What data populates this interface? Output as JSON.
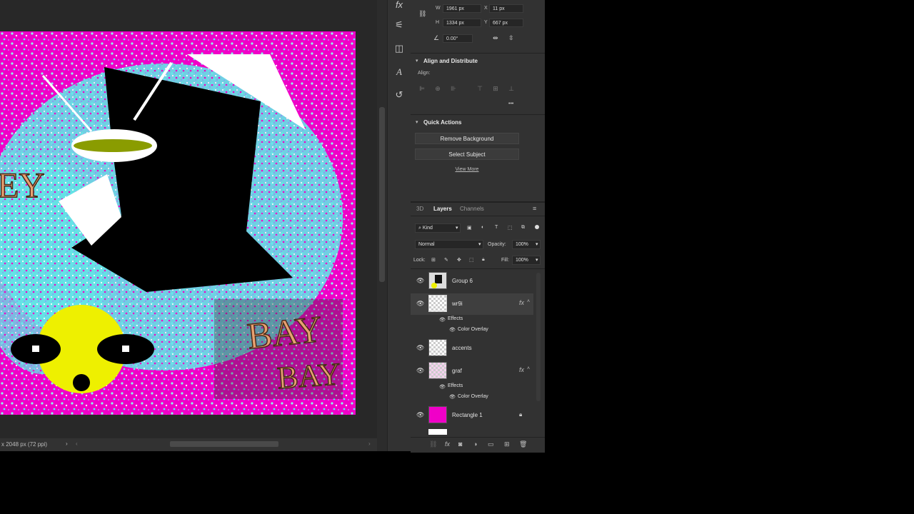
{
  "properties": {
    "w_label": "W",
    "w_value": "1961 px",
    "x_label": "X",
    "x_value": "11 px",
    "h_label": "H",
    "h_value": "1334 px",
    "y_label": "Y",
    "y_value": "667 px",
    "angle_value": "0.00°"
  },
  "align": {
    "title": "Align and Distribute",
    "sub_label": "Align:",
    "more": "•••"
  },
  "quick_actions": {
    "title": "Quick Actions",
    "remove_bg": "Remove Background",
    "select_subject": "Select Subject",
    "view_more": "View More"
  },
  "layers_panel": {
    "tabs": [
      "3D",
      "Layers",
      "Channels"
    ],
    "filter_label": "Kind",
    "blend_mode": "Normal",
    "opacity_label": "Opacity:",
    "opacity_value": "100%",
    "lock_label": "Lock:",
    "fill_label": "Fill:",
    "fill_value": "100%",
    "layers": [
      {
        "name": "Group 6"
      },
      {
        "name": "wr9i",
        "fx": "fx",
        "effects": "Effects",
        "overlay": "Color Overlay"
      },
      {
        "name": "accents"
      },
      {
        "name": "graf",
        "fx": "fx",
        "effects": "Effects",
        "overlay": "Color Overlay"
      },
      {
        "name": "Rectangle 1"
      }
    ]
  },
  "canvas": {
    "text_bay1": "BAY",
    "text_bay2": "BAY",
    "text_ey": "EY"
  },
  "status": {
    "doc_info": "x 2048 px (72 ppi)"
  },
  "colors": {
    "magenta": "#f000c8",
    "cyan": "#5ff0ea",
    "yellow": "#eef000",
    "olive": "#8a9c00"
  }
}
